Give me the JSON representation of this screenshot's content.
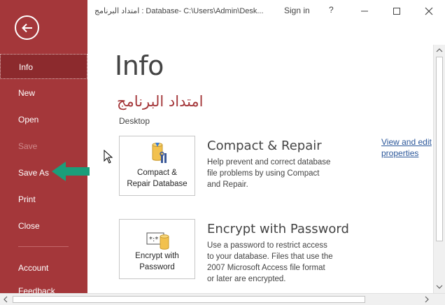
{
  "window": {
    "title": "امتداد البرنامج : Database- C:\\Users\\Admin\\Desk...",
    "sign_in": "Sign in",
    "help": "?"
  },
  "sidebar": {
    "items": [
      {
        "label": "Info",
        "state": "active"
      },
      {
        "label": "New",
        "state": "normal"
      },
      {
        "label": "Open",
        "state": "normal"
      },
      {
        "label": "Save",
        "state": "disabled"
      },
      {
        "label": "Save As",
        "state": "normal"
      },
      {
        "label": "Print",
        "state": "normal"
      },
      {
        "label": "Close",
        "state": "normal"
      },
      {
        "label": "Account",
        "state": "normal"
      },
      {
        "label": "Feedback",
        "state": "normal"
      }
    ]
  },
  "main": {
    "title": "Info",
    "database_name": "امتداد البرنامج",
    "database_path": "Desktop",
    "compact": {
      "card_line1": "Compact &",
      "card_line2": "Repair Database",
      "heading": "Compact & Repair",
      "desc1": "Help prevent and correct database",
      "desc2": "file problems by using Compact",
      "desc3": "and Repair."
    },
    "properties_link1": "View and edit",
    "properties_link2": "properties",
    "encrypt": {
      "card_line1": "Encrypt with",
      "card_line2": "Password",
      "heading": "Encrypt with Password",
      "desc1": "Use a password to restrict access",
      "desc2": "to your database. Files that use the",
      "desc3": "2007 Microsoft Access file format",
      "desc4": "or later are encrypted."
    }
  },
  "colors": {
    "accent": "#a4373a",
    "sidebar_active": "#8c2a2d",
    "annotation_arrow": "#1a9e7a",
    "link": "#2b579a"
  },
  "icons": {
    "back": "back-arrow-icon",
    "compact": "database-tools-icon",
    "encrypt": "database-lock-icon"
  }
}
